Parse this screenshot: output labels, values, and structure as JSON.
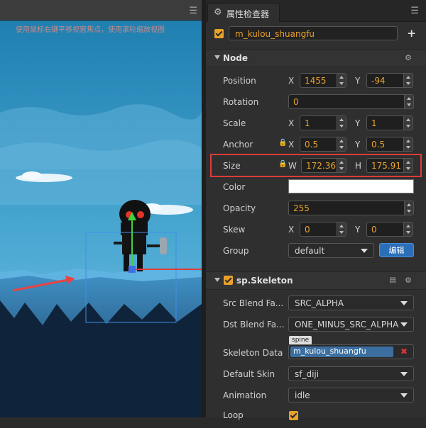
{
  "scene": {
    "hint": "使用鼠标右键平移视窗焦点，使用滚轮缩放视图"
  },
  "inspector": {
    "tab_title": "属性检查器",
    "node_name": "m_kulou_shuangfu",
    "node_section": "Node",
    "position": {
      "label": "Position",
      "x": "1455",
      "y": "-94"
    },
    "rotation": {
      "label": "Rotation",
      "value": "0"
    },
    "scale": {
      "label": "Scale",
      "x": "1",
      "y": "1"
    },
    "anchor": {
      "label": "Anchor",
      "x": "0.5",
      "y": "0.5"
    },
    "size": {
      "label": "Size",
      "w": "172.36",
      "h": "175.91"
    },
    "color": {
      "label": "Color",
      "value": "#ffffff"
    },
    "opacity": {
      "label": "Opacity",
      "value": "255"
    },
    "skew": {
      "label": "Skew",
      "x": "0",
      "y": "0"
    },
    "group": {
      "label": "Group",
      "value": "default",
      "edit_label": "编辑"
    },
    "axis": {
      "x": "X",
      "y": "Y",
      "w": "W",
      "h": "H"
    },
    "skeleton_section": "sp.Skeleton",
    "src_blend": {
      "label": "Src Blend Fa...",
      "value": "SRC_ALPHA"
    },
    "dst_blend": {
      "label": "Dst Blend Fa...",
      "value": "ONE_MINUS_SRC_ALPHA"
    },
    "skeleton_data": {
      "label": "Skeleton Data",
      "badge": "spine",
      "value": "m_kulou_shuangfu"
    },
    "default_skin": {
      "label": "Default Skin",
      "value": "sf_diji"
    },
    "animation": {
      "label": "Animation",
      "value": "idle"
    },
    "loop": {
      "label": "Loop"
    }
  },
  "colors": {
    "accent": "#e8a22a",
    "highlight": "#e03a3a",
    "button": "#2a6fb8"
  }
}
